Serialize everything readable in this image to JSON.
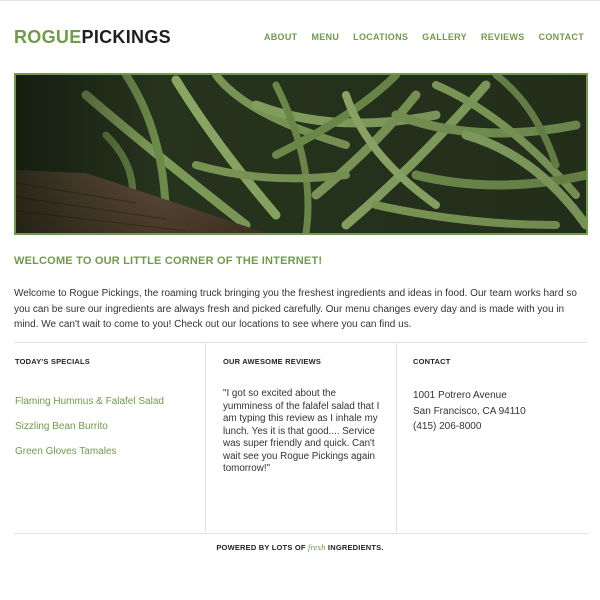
{
  "brand": {
    "part1": "ROGUE",
    "part2": "PICKINGS",
    "accent_color": "#6f9b4a"
  },
  "nav": {
    "items": [
      "ABOUT",
      "MENU",
      "LOCATIONS",
      "GALLERY",
      "REVIEWS",
      "CONTACT"
    ]
  },
  "hero": {
    "image_subject": "green beans in a wooden crate"
  },
  "welcome": {
    "heading": "WELCOME TO OUR LITTLE CORNER OF THE INTERNET!",
    "text": "Welcome to Rogue Pickings, the roaming truck bringing you the freshest ingredients and ideas in food. Our team works hard so you can be sure our ingredients are always fresh and picked carefully. Our menu changes every day and is made with you in mind. We can't wait to come to you! Check out our locations to see where you can find us."
  },
  "specials": {
    "title": "TODAY'S SPECIALS",
    "items": [
      "Flaming Hummus & Falafel Salad",
      "Sizzling Bean Burrito",
      "Green Gloves Tamales"
    ]
  },
  "reviews": {
    "title": "OUR AWESOME REVIEWS",
    "quote": "\"I got so excited about the yumminess of the falafel salad that I am typing this review as I inhale my lunch. Yes it is that good.... Service was super friendly and quick. Can't wait see you Rogue Pickings again tomorrow!\""
  },
  "contact": {
    "title": "CONTACT",
    "address_line1": "1001 Potrero Avenue",
    "address_line2": "San Francisco, CA 94110",
    "phone": "(415) 206-8000"
  },
  "footer": {
    "prefix": "POWERED BY LOTS OF",
    "fresh": "fresh",
    "suffix": "INGREDIENTS."
  }
}
